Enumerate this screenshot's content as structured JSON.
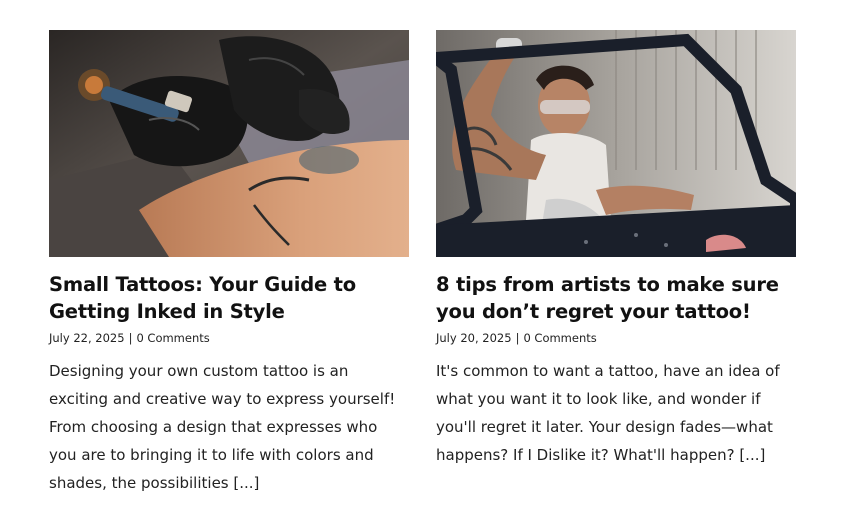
{
  "posts": [
    {
      "title": "Small Tattoos: Your Guide to Getting Inked in Style",
      "date": "July 22, 2025",
      "separator": "|",
      "comments": "0 Comments",
      "excerpt": "Designing your own custom tattoo is an exciting and creative way to express yourself! From choosing a design that expresses who you are to bringing it to life with colors and shades, the possibilities [...]"
    },
    {
      "title": "8 tips from artists to make sure you don’t regret your tattoo!",
      "date": "July 20, 2025",
      "separator": "|",
      "comments": "0 Comments",
      "excerpt": "It's common to want a tattoo, have an idea of what you want it to look like, and wonder if you'll regret it later. Your design fades—what happens? If I Dislike it? What'll happen? [...]"
    }
  ]
}
